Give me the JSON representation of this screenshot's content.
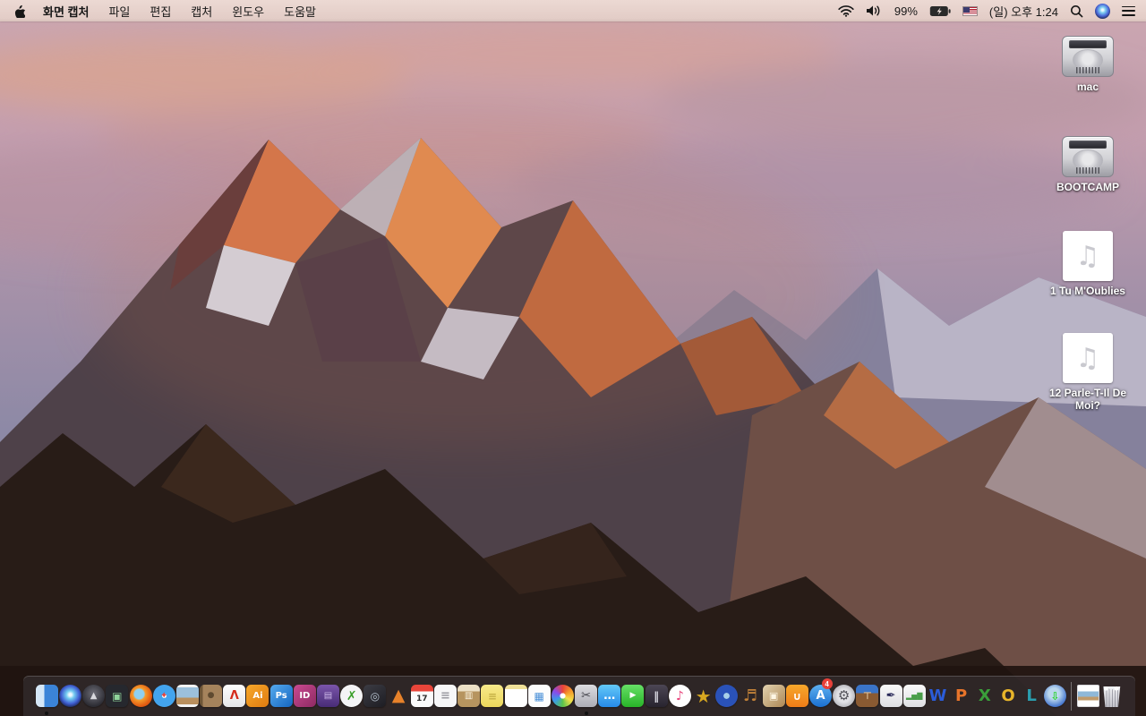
{
  "menu_bar": {
    "app_name": "화면 캡처",
    "menus": [
      "파일",
      "편집",
      "캡처",
      "윈도우",
      "도움말"
    ],
    "status": {
      "battery_percent": "99%",
      "battery_state": "charging",
      "datetime": "(일) 오후 1:24",
      "flag": "us-flag",
      "icons": [
        "wifi-icon",
        "volume-icon",
        "battery-icon",
        "input-source-flag",
        "clock",
        "spotlight-search-icon",
        "siri-icon",
        "notification-center-icon"
      ]
    }
  },
  "desktop": {
    "icons": [
      {
        "name": "mac-volume",
        "label": "mac",
        "type": "hard-drive"
      },
      {
        "name": "bootcamp-volume",
        "label": "BOOTCAMP",
        "type": "hard-drive"
      },
      {
        "name": "audio-file-1",
        "label": "1 Tu M'Oublies",
        "type": "audio-file"
      },
      {
        "name": "audio-file-2",
        "label": "12 Parle-T-Il De Moi?",
        "type": "audio-file"
      }
    ]
  },
  "dock": {
    "items": [
      {
        "name": "finder",
        "shape": "rounded",
        "bg": "linear-gradient(90deg,#d5e7f7 0 38%,#3b84d8 38%)",
        "glyph": "",
        "running": true
      },
      {
        "name": "siri",
        "shape": "circle",
        "bg": "radial-gradient(circle at 50% 45%, #eef8ff 0 8%, #74ccf0 24%, #3f5ed2 54%, #141b38 82%)",
        "glyph": ""
      },
      {
        "name": "launchpad",
        "shape": "circle",
        "bg": "radial-gradient(circle at 50% 40%, #6e6e78, #2c2c33 72%)",
        "glyph": "▲",
        "color": "#d9d9de",
        "fs": "10"
      },
      {
        "name": "mission-control",
        "shape": "rounded",
        "bg": "#26282e",
        "glyph": "▣",
        "color": "#8fd49a",
        "fs": "12"
      },
      {
        "name": "firefox",
        "shape": "circle",
        "bg": "radial-gradient(circle at 42% 42%, #8fd0f0 0 26%, #f59a2a 34%, #e25b12 66%, #b5430c 100%)",
        "glyph": ""
      },
      {
        "name": "safari",
        "shape": "circle",
        "bg": "radial-gradient(circle at 50% 50%, #f2f9ff 0 13%, #43a4ee 15% 100%)",
        "glyph": "✦",
        "color": "#e8433a",
        "fs": "10"
      },
      {
        "name": "preview",
        "shape": "rounded",
        "bg": "linear-gradient(180deg,#f2f2f2 0 12%, #9cc0dc 12% 58%, #b98f5e 58% 88%, #f2f2f2 88%)",
        "glyph": ""
      },
      {
        "name": "contacts",
        "shape": "rounded",
        "bg": "linear-gradient(90deg,#6f5637 0 14%, #a5835c 14%)",
        "glyph": "●",
        "color": "#5f4a30",
        "fs": "9"
      },
      {
        "name": "acrobat-reader",
        "shape": "rounded",
        "bg": "linear-gradient(180deg,#fdfdfd,#e6e6e8)",
        "glyph": "Λ",
        "color": "#d42a1a",
        "fs": "13"
      },
      {
        "name": "illustrator",
        "shape": "rounded",
        "bg": "linear-gradient(135deg,#f7a82b,#df7b10)",
        "glyph": "Ai",
        "color": "#ffffff",
        "fs": "10"
      },
      {
        "name": "photoshop",
        "shape": "rounded",
        "bg": "linear-gradient(135deg,#55aaee,#1565c0)",
        "glyph": "Ps",
        "color": "#ffffff",
        "fs": "10"
      },
      {
        "name": "indesign",
        "shape": "rounded",
        "bg": "linear-gradient(135deg,#c94a90,#8e2a63)",
        "glyph": "ID",
        "color": "#ffffff",
        "fs": "10"
      },
      {
        "name": "toast",
        "shape": "rounded",
        "bg": "linear-gradient(180deg,#7a55aa,#482c76)",
        "glyph": "▤",
        "color": "#cdb8e8",
        "fs": "10"
      },
      {
        "name": "green-x-app",
        "shape": "circle",
        "bg": "#f4f4f6",
        "glyph": "✗",
        "color": "#3a9e2a",
        "fs": "14"
      },
      {
        "name": "disc-burner",
        "shape": "rounded",
        "bg": "linear-gradient(145deg,#3c3c44,#1d1d23)",
        "glyph": "◎",
        "color": "#b8c4d0",
        "fs": "12"
      },
      {
        "name": "vlc",
        "shape": "none",
        "glyph": "▲",
        "color": "#e8822a",
        "fs": "19"
      },
      {
        "name": "calendar",
        "shape": "rounded",
        "bg": "linear-gradient(180deg,#e8453a 0 30%, #fbfbfb 30%)",
        "glyph": "17",
        "color": "#2f2f2f",
        "fs": "9",
        "pad": "7"
      },
      {
        "name": "reminders",
        "shape": "rounded",
        "bg": "#f7f7f8",
        "glyph": "≡",
        "color": "#9a9aa0",
        "fs": "13"
      },
      {
        "name": "archive-utility",
        "shape": "rounded",
        "bg": "linear-gradient(180deg,#ece0c6 0 30%, #b6945f 30%)",
        "glyph": "▥",
        "color": "#fdf6e4",
        "fs": "10"
      },
      {
        "name": "stickies",
        "shape": "rounded",
        "bg": "linear-gradient(180deg,#f7e98a,#ecd75c)",
        "glyph": "≡",
        "color": "#c6b148",
        "fs": "12"
      },
      {
        "name": "notepad",
        "shape": "rounded",
        "bg": "linear-gradient(180deg,#efe098 0 20%, #ffffff 20%)",
        "glyph": ""
      },
      {
        "name": "document-viewer",
        "shape": "rounded",
        "bg": "#fcfcfc",
        "glyph": "▦",
        "color": "#4a90d8",
        "fs": "12"
      },
      {
        "name": "photos",
        "shape": "circle",
        "bg": "radial-gradient(circle, #ffffff 0 17%, rgba(255,255,255,0) 18%), conic-gradient(#e8433a, #f59a2a, #f3e04a, #5ac44a, #3a9ae8, #8a4ae8, #e8433a)",
        "glyph": ""
      },
      {
        "name": "grab-screen-capture",
        "shape": "rounded",
        "bg": "linear-gradient(180deg,#dcdce0,#aeaeb6)",
        "glyph": "✂",
        "color": "#45454c",
        "fs": "13",
        "running": true
      },
      {
        "name": "messages",
        "shape": "rounded",
        "bg": "linear-gradient(180deg,#62c8f8,#278ae8)",
        "glyph": "…",
        "color": "#ffffff",
        "fs": "13"
      },
      {
        "name": "facetime",
        "shape": "rounded",
        "bg": "linear-gradient(180deg,#66e066,#28b328)",
        "glyph": "▶",
        "color": "#ffffff",
        "fs": "9"
      },
      {
        "name": "photo-booth",
        "shape": "rounded",
        "bg": "linear-gradient(180deg,#4c4654,#28242f)",
        "glyph": "‖",
        "color": "#d8d8e0",
        "fs": "12"
      },
      {
        "name": "itunes",
        "shape": "circle",
        "bg": "radial-gradient(circle,#ffffff 0 72%, #e6e6ec 100%)",
        "glyph": "♪",
        "color": "#e8437a",
        "fs": "14"
      },
      {
        "name": "imovie",
        "shape": "none",
        "glyph": "★",
        "color": "#d8a820",
        "fs": "20"
      },
      {
        "name": "idvd",
        "shape": "circle",
        "bg": "radial-gradient(circle at 50% 50%, #a8d0e8 0 18%, #2a52b8 20% 100%)",
        "glyph": ""
      },
      {
        "name": "garageband",
        "shape": "none",
        "glyph": "♬",
        "color": "#c08038",
        "fs": "18"
      },
      {
        "name": "scrapbook",
        "shape": "rounded",
        "bg": "linear-gradient(135deg,#e2d2b0,#ad8754)",
        "glyph": "▣",
        "color": "#fdf6e4",
        "fs": "11"
      },
      {
        "name": "ibooks",
        "shape": "rounded",
        "bg": "linear-gradient(180deg,#f7a72b,#ee7c18)",
        "glyph": "∪",
        "color": "#ffffff",
        "fs": "12"
      },
      {
        "name": "app-store",
        "shape": "circle",
        "bg": "linear-gradient(180deg,#5db0f0,#1a6fd0)",
        "glyph": "A",
        "color": "#ffffff",
        "fs": "13",
        "badge": "4"
      },
      {
        "name": "system-preferences",
        "shape": "circle",
        "bg": "radial-gradient(circle,#e2e2e6 0 40%, #96969e 100%)",
        "glyph": "⚙",
        "color": "#52525a",
        "fs": "15"
      },
      {
        "name": "keynote",
        "shape": "rounded",
        "bg": "linear-gradient(180deg,#3a74c8 0 38%, #8a5a32 38%)",
        "glyph": "⊤",
        "color": "#d9b992",
        "fs": "11"
      },
      {
        "name": "pages",
        "shape": "rounded",
        "bg": "linear-gradient(180deg,#fafafa,#dedee2)",
        "glyph": "✒",
        "color": "#2a2a5a",
        "fs": "13"
      },
      {
        "name": "numbers",
        "shape": "rounded",
        "bg": "linear-gradient(180deg,#fafafa,#dedee2)",
        "glyph": "▂▅▇",
        "color": "#4a9e4a",
        "fs": "8"
      },
      {
        "name": "word",
        "shape": "none",
        "glyph": "W",
        "color": "#2b5cd8",
        "fs": "18"
      },
      {
        "name": "powerpoint",
        "shape": "none",
        "glyph": "P",
        "color": "#e8742a",
        "fs": "18"
      },
      {
        "name": "excel",
        "shape": "none",
        "glyph": "X",
        "color": "#3a9e3a",
        "fs": "18"
      },
      {
        "name": "outlook",
        "shape": "none",
        "glyph": "O",
        "color": "#e8b52a",
        "fs": "18"
      },
      {
        "name": "lync",
        "shape": "none",
        "glyph": "L",
        "color": "#2a9eae",
        "fs": "18"
      },
      {
        "name": "downloader",
        "shape": "circle",
        "bg": "radial-gradient(circle at 45% 40%, #bcd8ee 0 30%, #4a7ad0 70%, #25459a 100%)",
        "glyph": "⇩",
        "color": "#2ad42a",
        "fs": "12"
      },
      {
        "type": "separator"
      },
      {
        "name": "downloaded-image-file",
        "shape": "none",
        "cls": "docfile",
        "bg": "linear-gradient(180deg,#ffffff 0 28%, #8fb8d8 28% 55%, #c09a6a 55% 72%, #ffffff 72%)",
        "glyph": ""
      },
      {
        "name": "trash-full",
        "shape": "none",
        "cls": "trash",
        "glyph": ""
      }
    ]
  },
  "colors": {
    "menubar_bg": "#e8d4ce",
    "dock_bg": "rgba(58,52,56,0.55)",
    "badge_red": "#e8413a",
    "sky_top": "#c9a6b2",
    "sky_bottom": "#7d7f9d",
    "sunlit_rock": "#d4764a",
    "foreground_rock": "#281c17"
  }
}
